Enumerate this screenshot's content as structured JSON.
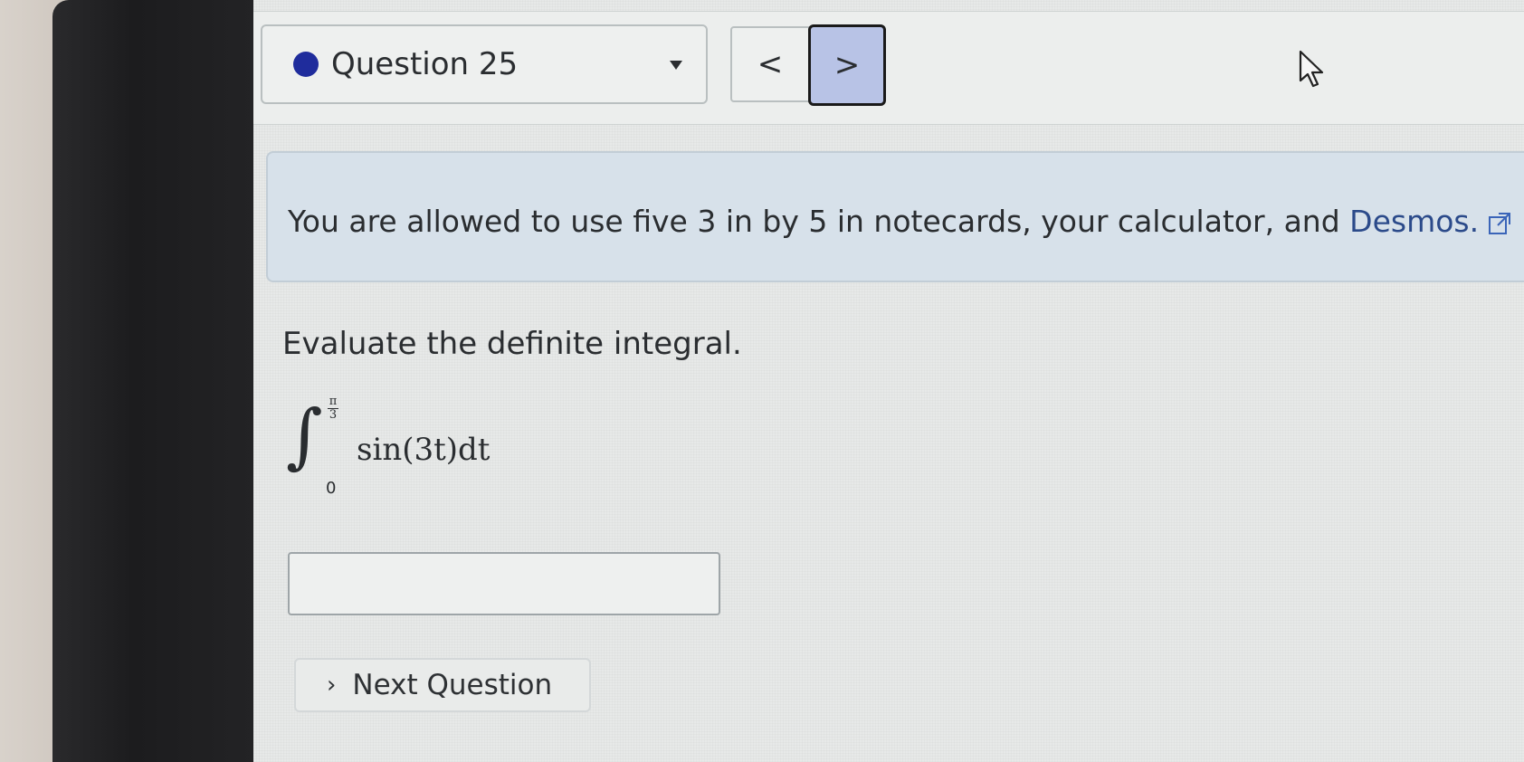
{
  "header": {
    "question_label": "Question 25",
    "prev_glyph": "<",
    "next_glyph": ">",
    "status_color": "#1f2c9c"
  },
  "info": {
    "text_before_link": "You are allowed to use five 3 in by 5 in notecards, your calculator, and ",
    "link_text": "Desmos.",
    "icon": "external-link-icon"
  },
  "question": {
    "prompt": "Evaluate the definite integral.",
    "upper_limit_numerator": "π",
    "upper_limit_denominator": "3",
    "lower_limit": "0",
    "integrand": "sin(3t)dt"
  },
  "answer": {
    "value": ""
  },
  "footer": {
    "next_question_label": "Next Question"
  }
}
